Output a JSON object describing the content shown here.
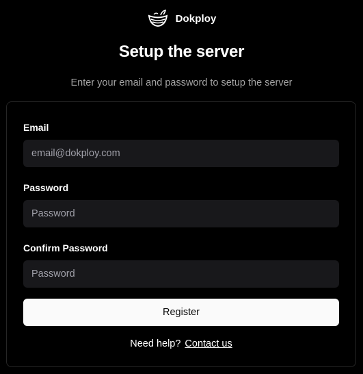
{
  "brand": {
    "name": "Dokploy",
    "logo_icon": "whale-logo-icon"
  },
  "page": {
    "title": "Setup the server",
    "subtitle": "Enter your email and password to setup the server"
  },
  "form": {
    "email": {
      "label": "Email",
      "placeholder": "email@dokploy.com",
      "value": ""
    },
    "password": {
      "label": "Password",
      "placeholder": "Password",
      "value": ""
    },
    "confirm_password": {
      "label": "Confirm Password",
      "placeholder": "Password",
      "value": ""
    },
    "register_label": "Register"
  },
  "help": {
    "text": "Need help?",
    "link_label": "Contact us"
  },
  "colors": {
    "background": "#000000",
    "card_border": "#262626",
    "input_bg": "#18181b",
    "button_bg": "#fafafa",
    "muted_text": "#a3a3a3"
  }
}
